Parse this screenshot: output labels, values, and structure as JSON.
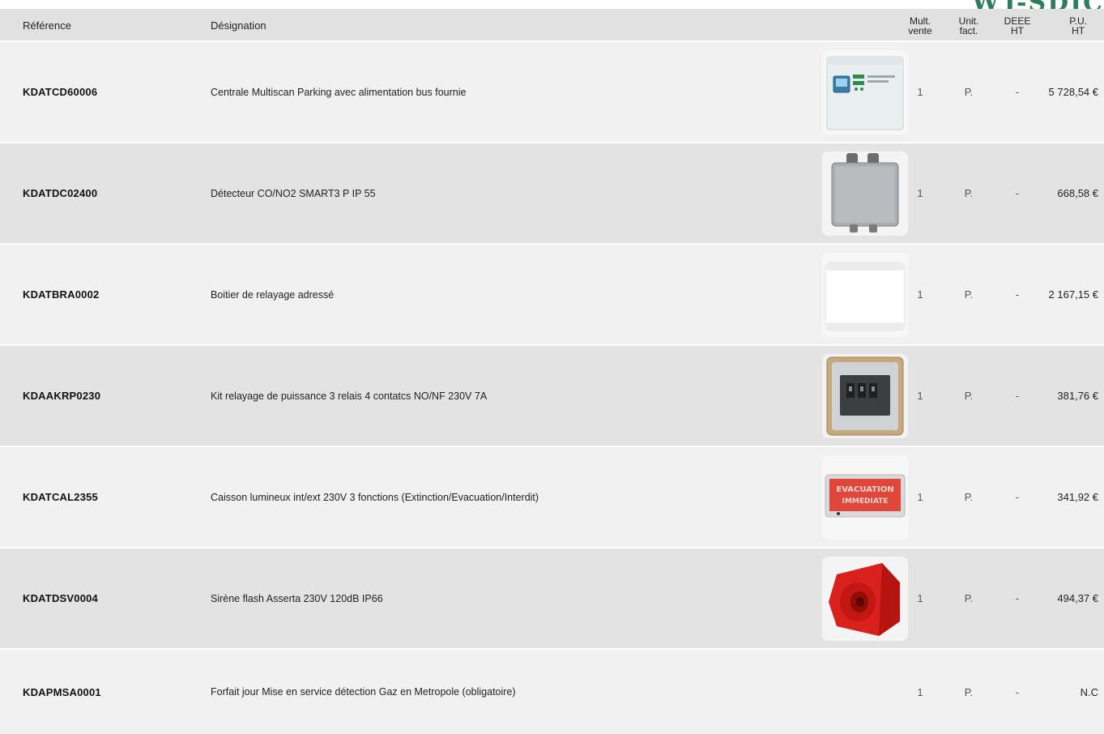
{
  "brand": "WT-SDIC",
  "header": {
    "reference": "Référence",
    "designation": "Désignation",
    "mult": "Mult.\nvente",
    "unit": "Unit.\nfact.",
    "deee": "DEEE\nHT",
    "pu": "P.U.\nHT"
  },
  "rows": [
    {
      "ref": "KDATCD60006",
      "designation": "Centrale Multiscan Parking avec alimentation bus fournie",
      "mult": "1",
      "unit": "P.",
      "deee": "-",
      "price": "5 728,54 €",
      "image": "control-panel-image"
    },
    {
      "ref": "KDATDC02400",
      "designation": "Détecteur CO/NO2 SMART3 P IP 55",
      "mult": "1",
      "unit": "P.",
      "deee": "-",
      "price": "668,58 €",
      "image": "detector-box-image"
    },
    {
      "ref": "KDATBRA0002",
      "designation": "Boitier de relayage adressé",
      "mult": "1",
      "unit": "P.",
      "deee": "-",
      "price": "2 167,15 €",
      "image": "relay-box-image"
    },
    {
      "ref": "KDAAKRP0230",
      "designation": "Kit relayage de puissance 3 relais 4 contatcs NO/NF 230V 7A",
      "mult": "1",
      "unit": "P.",
      "deee": "-",
      "price": "381,76 €",
      "image": "relay-kit-image"
    },
    {
      "ref": "KDATCAL2355",
      "designation": "Caisson lumineux int/ext 230V 3 fonctions (Extinction/Evacuation/Interdit)",
      "mult": "1",
      "unit": "P.",
      "deee": "-",
      "price": "341,92 €",
      "image": "light-sign-image",
      "sign_line1": "EVACUATION",
      "sign_line2": "IMMEDIATE"
    },
    {
      "ref": "KDATDSV0004",
      "designation": "Sirène flash Asserta 230V 120dB IP66",
      "mult": "1",
      "unit": "P.",
      "deee": "-",
      "price": "494,37 €",
      "image": "siren-image"
    },
    {
      "ref": "KDAPMSA0001",
      "designation": "Forfait jour Mise en service détection Gaz en Metropole (obligatoire)",
      "mult": "1",
      "unit": "P.",
      "deee": "-",
      "price": "N.C",
      "image": ""
    }
  ],
  "colors": {
    "row_light": "#f1f1f1",
    "row_dark": "#e3e3e3",
    "header_bg": "#e1e1e1",
    "siren_red": "#d8201c",
    "sign_red": "#e0473a",
    "brand_green": "#2e7d5b"
  }
}
